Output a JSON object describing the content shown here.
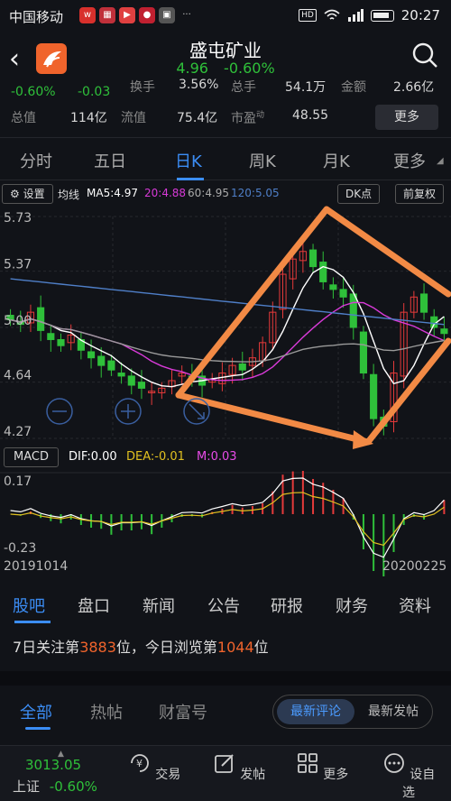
{
  "status": {
    "carrier": "中国移动",
    "time": "20:27",
    "hd": "HD",
    "battery": 0.85
  },
  "header": {
    "name": "盛屯矿业",
    "price": "4.96",
    "change": "-0.60%"
  },
  "quote": {
    "row0": [
      "-0.60%",
      "-0.03",
      "换手",
      "3.56%",
      "总手",
      "54.1万",
      "金额",
      "2.66亿"
    ],
    "row1": {
      "total_label": "总值",
      "total_value": "114亿",
      "float_label": "流值",
      "float_value": "75.4亿",
      "pe_label": "市盈",
      "pe_sup": "动",
      "pe_value": "48.55"
    },
    "more_btn": "更多"
  },
  "tabs": [
    "分时",
    "五日",
    "日K",
    "周K",
    "月K",
    "更多"
  ],
  "active_tab": 2,
  "toolbar": {
    "settings": "设置",
    "ma_label": "均线",
    "ma5": "MA5:4.97",
    "ma20": "20:4.88",
    "ma60": "60:4.95",
    "ma120": "120:5.05",
    "dk": "DK点",
    "adjust": "前复权"
  },
  "chart_data": {
    "type": "candlestick",
    "y_ticks": [
      "5.73",
      "5.37",
      "5.00",
      "4.64",
      "4.27"
    ],
    "ylim": [
      4.27,
      5.73
    ],
    "colors": {
      "ma5": "#ffffff",
      "ma20": "#d83ad8",
      "ma60": "#9a9a9a",
      "ma120": "#4f7fc8",
      "up": "#e53a3a",
      "down": "#2fc03a",
      "annotation": "#f28a45"
    },
    "close_approx": [
      5.05,
      5.02,
      5.1,
      4.98,
      4.92,
      4.88,
      4.95,
      4.85,
      4.8,
      4.75,
      4.72,
      4.68,
      4.62,
      4.6,
      4.58,
      4.6,
      4.65,
      4.7,
      4.68,
      4.62,
      4.66,
      4.7,
      4.75,
      4.72,
      4.8,
      4.9,
      5.1,
      5.35,
      5.45,
      5.5,
      5.4,
      5.3,
      5.25,
      5.2,
      5.0,
      4.7,
      4.4,
      4.35,
      4.7,
      5.1,
      5.2,
      5.1,
      5.0,
      4.96
    ],
    "macd": {
      "label": "MACD",
      "dif": "DIF:0.00",
      "dea": "DEA:-0.01",
      "m": "M:0.03",
      "y_ticks": [
        "0.17",
        "-0.23"
      ],
      "colors": {
        "dif": "#ffffff",
        "dea": "#e0c020",
        "m": "#e84be8"
      }
    },
    "date_start": "20191014",
    "date_end": "20200225"
  },
  "bottom_tabs": [
    "股吧",
    "盘口",
    "新闻",
    "公告",
    "研报",
    "财务",
    "资料"
  ],
  "follow": {
    "p1": "7日关注第",
    "rank1": "3883",
    "p2": "位，今日浏览第",
    "rank2": "1044",
    "p3": "位"
  },
  "feed_tabs": [
    "全部",
    "热帖",
    "财富号"
  ],
  "toggle": [
    "最新评论",
    "最新发帖"
  ],
  "bottombar": {
    "index_value": "3013.05",
    "index_name": "上证",
    "index_change": "-0.60%",
    "items": [
      "交易",
      "发帖",
      "更多",
      "设自选"
    ]
  }
}
